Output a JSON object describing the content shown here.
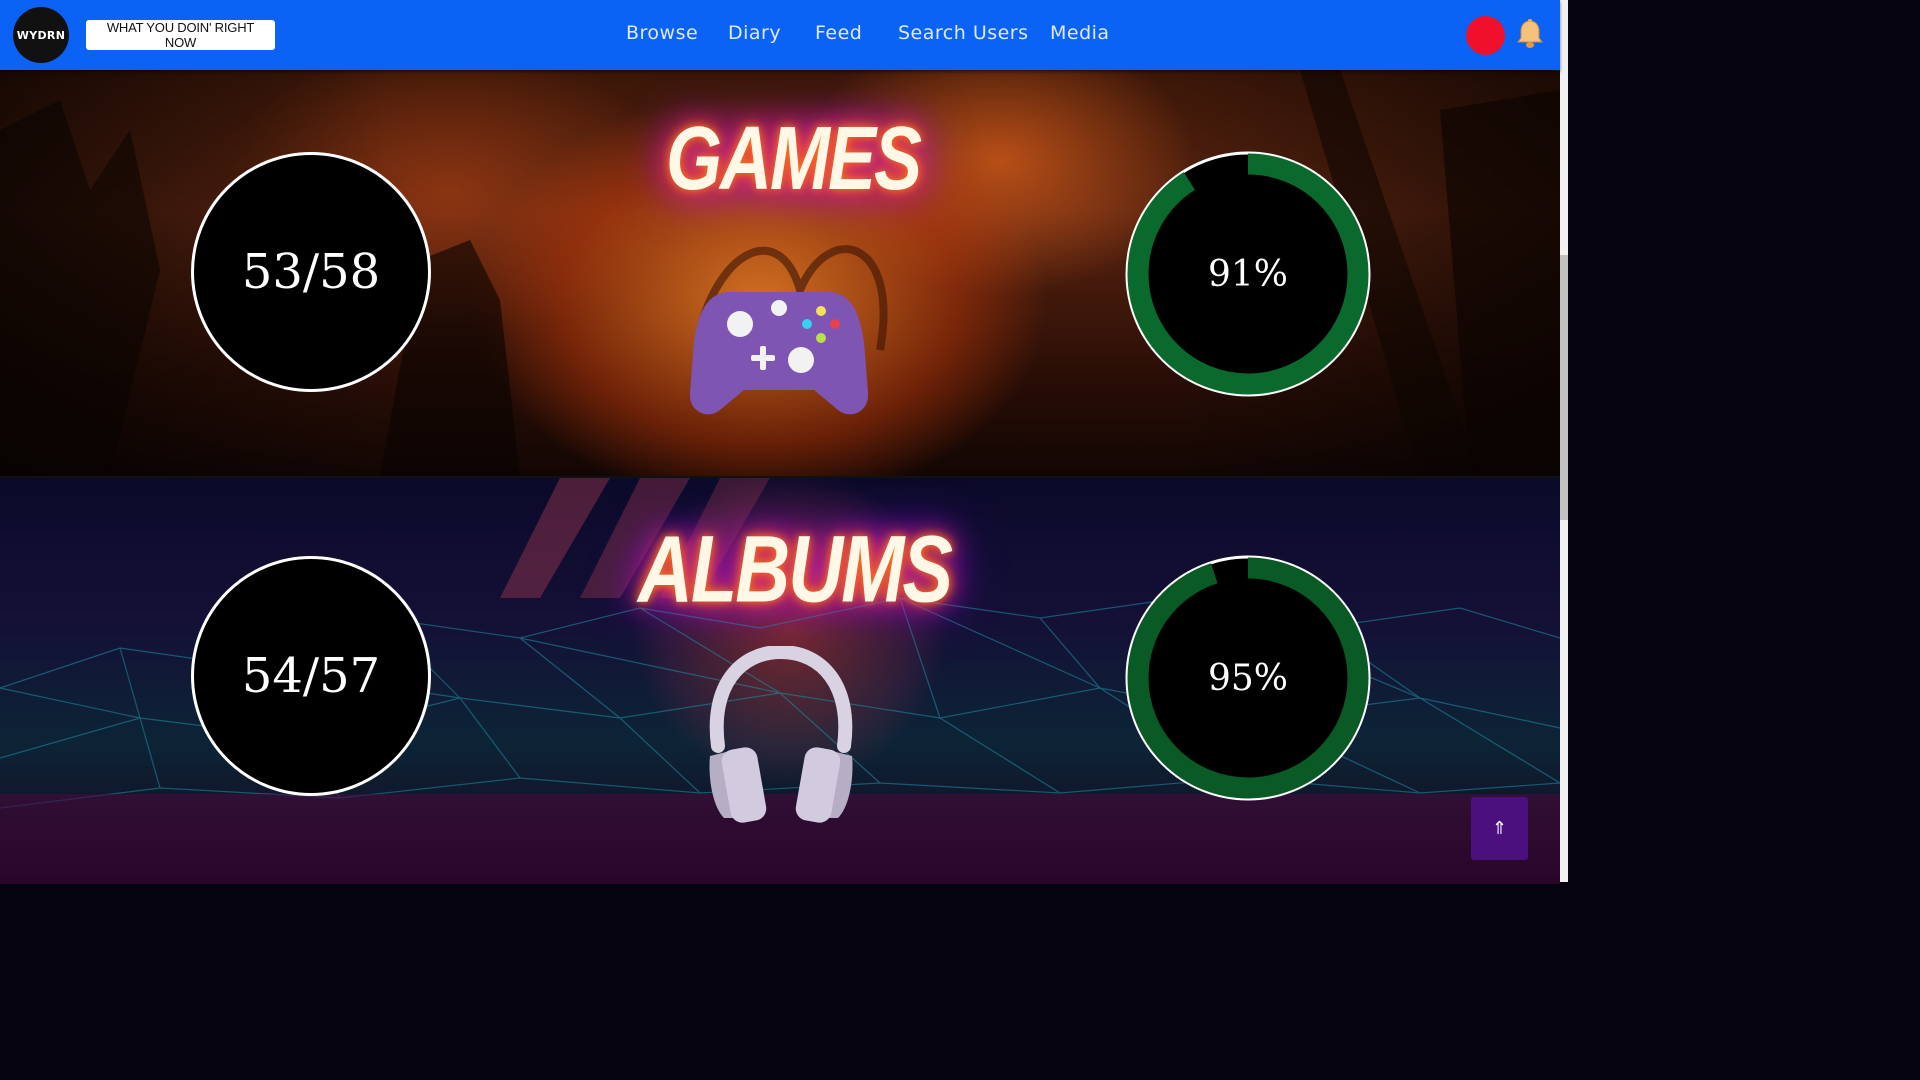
{
  "nav": {
    "logo": "WYDRN",
    "status_button": "WHAT YOU DOIN' RIGHT NOW",
    "links": [
      "Browse",
      "Diary",
      "Feed",
      "Search Users",
      "Media"
    ]
  },
  "sections": [
    {
      "title": "GAMES",
      "count": "53/58",
      "percent_label": "91%",
      "percent": 0.91,
      "icon": "game-controller-icon"
    },
    {
      "title": "ALBUMS",
      "count": "54/57",
      "percent_label": "95%",
      "percent": 0.95,
      "icon": "headphones-icon"
    }
  ],
  "back_to_top": "⇑",
  "colors": {
    "nav": "#0b63f6",
    "ring": "#0a6a2e",
    "avatar": "#f0102b",
    "top_button": "#4b0f7e"
  }
}
